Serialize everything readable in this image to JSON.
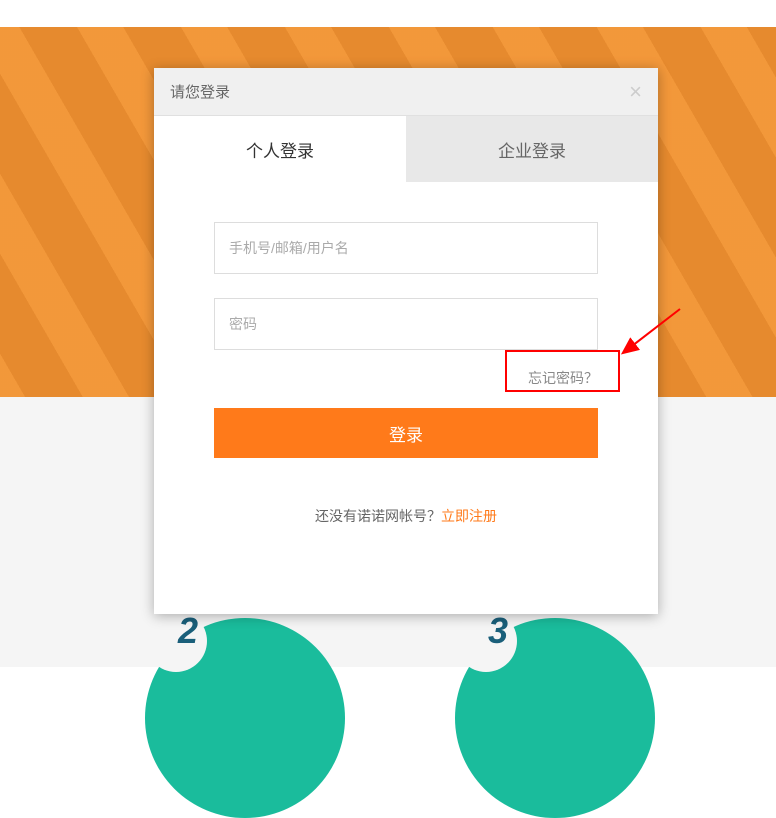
{
  "modal": {
    "title": "请您登录",
    "tabs": {
      "personal": "个人登录",
      "enterprise": "企业登录"
    },
    "form": {
      "username_placeholder": "手机号/邮箱/用户名",
      "password_placeholder": "密码",
      "forgot_password": "忘记密码？",
      "login_button": "登录",
      "register_prompt": "还没有诺诺网帐号？",
      "register_link": "立即注册"
    }
  },
  "steps": {
    "step1": "2",
    "step2": "3"
  }
}
